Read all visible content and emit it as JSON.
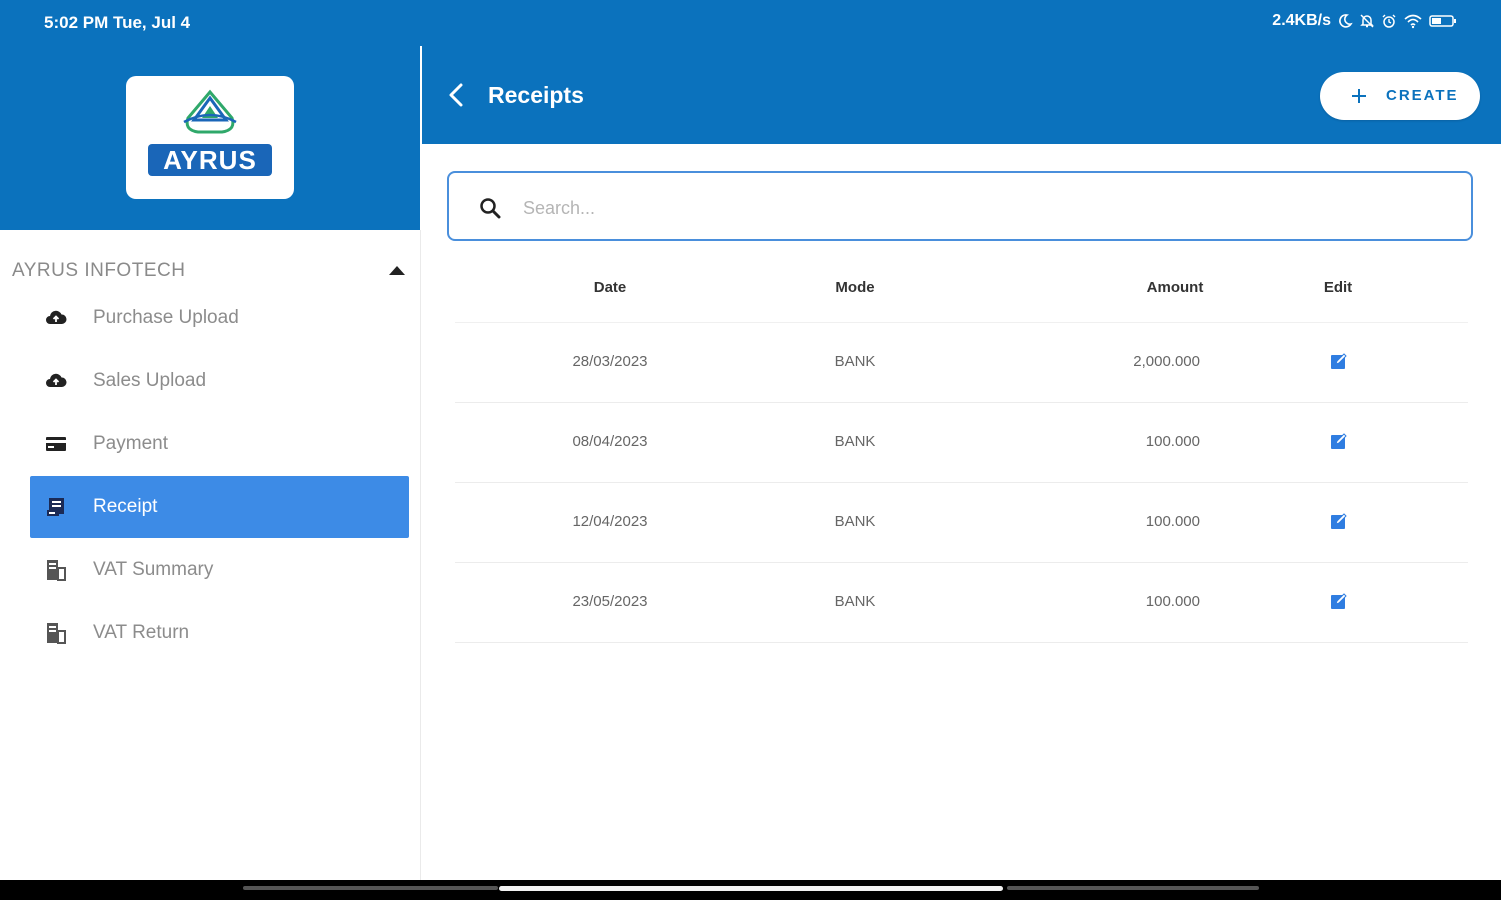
{
  "status_bar": {
    "time": "5:02 PM Tue, Jul 4",
    "network_speed": "2.4KB/s",
    "icons": [
      "moon-icon",
      "bell-off-icon",
      "alarm-icon",
      "wifi-icon",
      "battery-icon"
    ]
  },
  "brand": {
    "logo_text": "AYRUS",
    "accent_color": "#0b72bd",
    "active_color": "#3d8be6"
  },
  "sidebar": {
    "section_title": "AYRUS INFOTECH",
    "items": [
      {
        "label": "Purchase Upload",
        "icon": "cloud-upload-icon",
        "active": false
      },
      {
        "label": "Sales Upload",
        "icon": "cloud-upload-icon",
        "active": false
      },
      {
        "label": "Payment",
        "icon": "card-icon",
        "active": false
      },
      {
        "label": "Receipt",
        "icon": "receipt-icon",
        "active": true
      },
      {
        "label": "VAT Summary",
        "icon": "document-icon",
        "active": false
      },
      {
        "label": "VAT Return",
        "icon": "document-icon",
        "active": false
      }
    ]
  },
  "header": {
    "title": "Receipts",
    "create_label": "CREATE"
  },
  "search": {
    "placeholder": "Search..."
  },
  "table": {
    "columns": [
      "Date",
      "Mode",
      "Amount",
      "Edit"
    ],
    "rows": [
      {
        "date": "28/03/2023",
        "mode": "BANK",
        "amount": "2,000.000"
      },
      {
        "date": "08/04/2023",
        "mode": "BANK",
        "amount": "100.000"
      },
      {
        "date": "12/04/2023",
        "mode": "BANK",
        "amount": "100.000"
      },
      {
        "date": "23/05/2023",
        "mode": "BANK",
        "amount": "100.000"
      }
    ]
  }
}
